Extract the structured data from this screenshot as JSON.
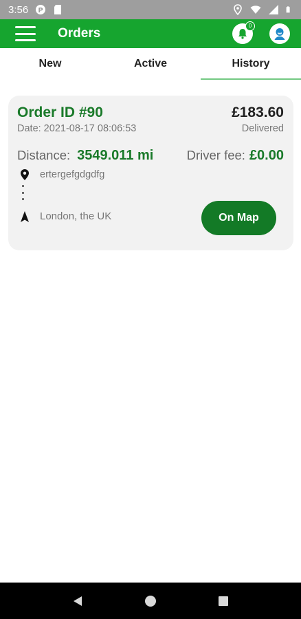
{
  "status_bar": {
    "time": "3:56",
    "left_icons": [
      "app-notification-icon",
      "sd-card-icon"
    ],
    "right_icons": [
      "location-icon",
      "wifi-icon",
      "cell-signal-icon",
      "battery-icon"
    ]
  },
  "app_bar": {
    "title": "Orders",
    "notification_count": "0",
    "color": "#16a52f"
  },
  "tabs": [
    {
      "label": "New",
      "active": false
    },
    {
      "label": "Active",
      "active": false
    },
    {
      "label": "History",
      "active": true
    }
  ],
  "order": {
    "id": "Order ID #90",
    "price": "£183.60",
    "date": "Date: 2021-08-17 08:06:53",
    "status": "Delivered",
    "distance_label": "Distance:",
    "distance_value": "3549.011 mi",
    "driver_fee_label": "Driver fee:",
    "driver_fee_value": "£0.00",
    "pickup_address": "ertergefgdgdfg",
    "destination_address": "London, the UK",
    "map_button": "On Map",
    "accent_color": "#1a7a2a"
  },
  "nav_bar": {
    "buttons": [
      "back-icon",
      "home-icon",
      "recents-icon"
    ]
  }
}
